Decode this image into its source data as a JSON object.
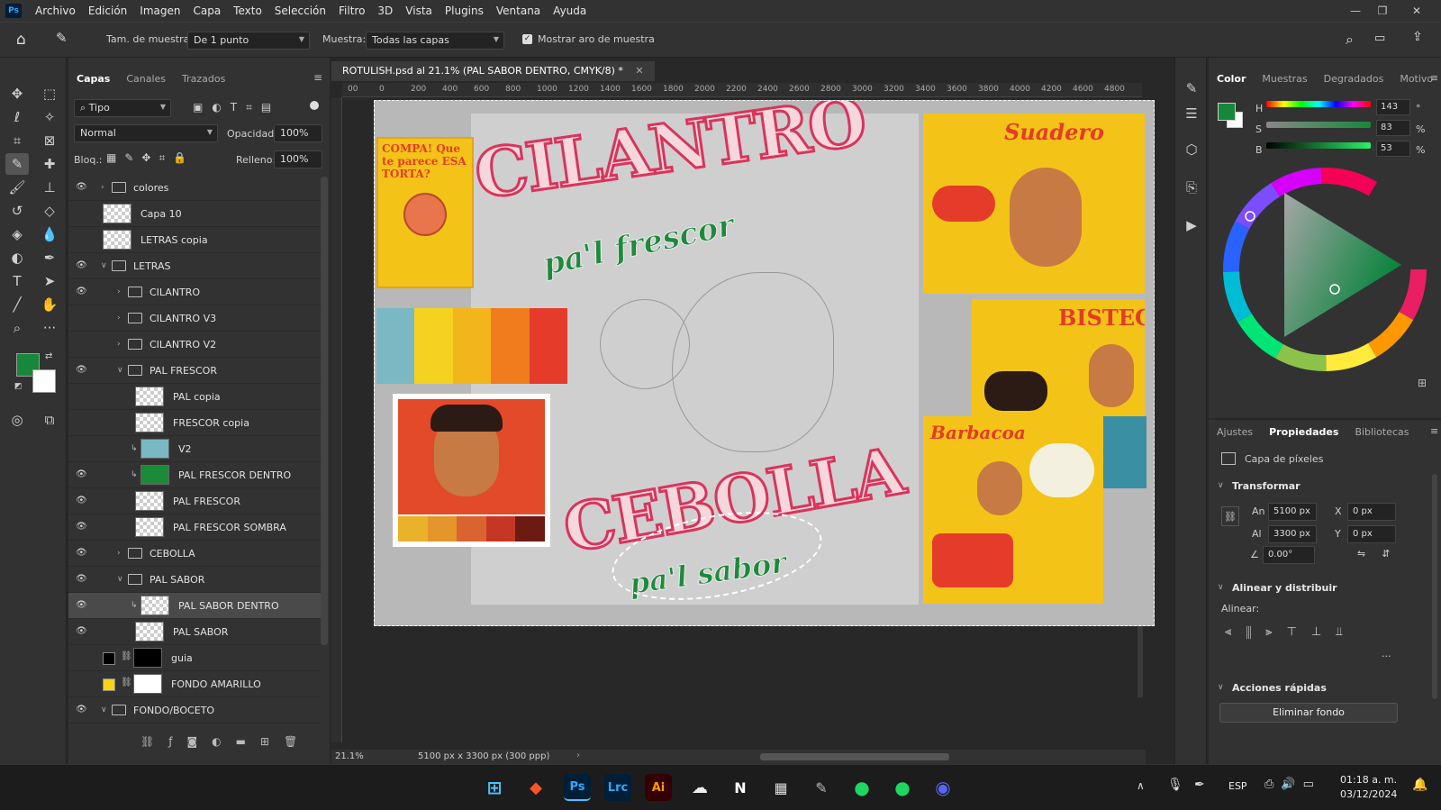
{
  "menu": {
    "logo": "Ps",
    "items": [
      "Archivo",
      "Edición",
      "Imagen",
      "Capa",
      "Texto",
      "Selección",
      "Filtro",
      "3D",
      "Vista",
      "Plugins",
      "Ventana",
      "Ayuda"
    ]
  },
  "options": {
    "sample_size_label": "Tam. de muestra:",
    "sample_size_value": "De 1 punto",
    "sample_label": "Muestra:",
    "sample_value": "Todas las capas",
    "show_ring_label": "Mostrar aro de muestra"
  },
  "layers_panel": {
    "tabs": [
      "Capas",
      "Canales",
      "Trazados"
    ],
    "filter_value": "Tipo",
    "blend_mode": "Normal",
    "opacity_label": "Opacidad:",
    "opacity_value": "100%",
    "lock_label": "Bloq.:",
    "fill_label": "Relleno:",
    "fill_value": "100%",
    "layers": [
      {
        "name": "colores",
        "visible": true,
        "kind": "folder",
        "indent": 0,
        "collapsed": true
      },
      {
        "name": "Capa 10",
        "visible": false,
        "kind": "pixel",
        "indent": 0
      },
      {
        "name": "LETRAS copia",
        "visible": false,
        "kind": "pixel",
        "indent": 0
      },
      {
        "name": "LETRAS",
        "visible": true,
        "kind": "folder",
        "indent": 0,
        "collapsed": false
      },
      {
        "name": "CILANTRO",
        "visible": true,
        "kind": "folder",
        "indent": 1,
        "collapsed": true
      },
      {
        "name": "CILANTRO V3",
        "visible": false,
        "kind": "folder",
        "indent": 1,
        "collapsed": true
      },
      {
        "name": "CILANTRO V2",
        "visible": false,
        "kind": "folder",
        "indent": 1,
        "collapsed": true
      },
      {
        "name": "PAL FRESCOR",
        "visible": true,
        "kind": "folder",
        "indent": 1,
        "collapsed": false
      },
      {
        "name": "PAL copia",
        "visible": false,
        "kind": "pixel",
        "indent": 2
      },
      {
        "name": "FRESCOR copia",
        "visible": false,
        "kind": "pixel",
        "indent": 2
      },
      {
        "name": "V2",
        "visible": false,
        "kind": "pixel",
        "indent": 2,
        "thumb_color": "#7ab8c4"
      },
      {
        "name": "PAL FRESCOR DENTRO",
        "visible": true,
        "kind": "pixel",
        "indent": 2,
        "thumb_color": "#1d8a3a"
      },
      {
        "name": "PAL FRESCOR",
        "visible": true,
        "kind": "pixel",
        "indent": 2
      },
      {
        "name": "PAL FRESCOR SOMBRA",
        "visible": true,
        "kind": "pixel",
        "indent": 2
      },
      {
        "name": "CEBOLLA",
        "visible": true,
        "kind": "folder",
        "indent": 1,
        "collapsed": true
      },
      {
        "name": "PAL SABOR",
        "visible": true,
        "kind": "folder",
        "indent": 1,
        "collapsed": false
      },
      {
        "name": "PAL SABOR DENTRO",
        "visible": true,
        "kind": "pixel",
        "indent": 2,
        "selected": true
      },
      {
        "name": "PAL SABOR",
        "visible": true,
        "kind": "pixel",
        "indent": 2
      },
      {
        "name": "guia",
        "visible": false,
        "kind": "fill",
        "indent": 0,
        "thumb_color": "#000000"
      },
      {
        "name": "FONDO AMARILLO",
        "visible": false,
        "kind": "fill",
        "indent": 0,
        "thumb_color": "#f7d417"
      },
      {
        "name": "FONDO/BOCETO",
        "visible": true,
        "kind": "folder",
        "indent": 0,
        "collapsed": false
      }
    ]
  },
  "document": {
    "tab_title": "ROTULISH.psd al 21.1% (PAL SABOR DENTRO, CMYK/8) *",
    "ruler_ticks": [
      "00",
      "0",
      "200",
      "400",
      "600",
      "800",
      "1000",
      "1200",
      "1400",
      "1600",
      "1800",
      "2000",
      "2200",
      "2400",
      "2600",
      "2800",
      "3000",
      "3200",
      "3400",
      "3600",
      "3800",
      "4000",
      "4200",
      "4600",
      "4800"
    ],
    "zoom": "21.1%",
    "size_info": "5100 px x 3300 px (300 ppp)",
    "artwork": {
      "title_word": "CILANTRO",
      "title_sub": "pa'l frescor",
      "bottom_word": "CEBOLLA",
      "bottom_sub": "pa'l sabor",
      "poster_torta": "COMPA! Que te parece ESA TORTA?",
      "poster_suadero": "Suadero",
      "poster_bistec": "BISTEC",
      "poster_barbacoa": "Barbacoa",
      "palette": [
        "#7ab8c4",
        "#f4d21f",
        "#f2b51c",
        "#f07c1e",
        "#e53b2a"
      ]
    }
  },
  "color_panel": {
    "tabs": [
      "Color",
      "Muestras",
      "Degradados",
      "Motivo"
    ],
    "h_label": "H",
    "h_value": "143",
    "h_unit": "°",
    "s_label": "S",
    "s_value": "83",
    "s_unit": "%",
    "b_label": "B",
    "b_value": "53",
    "b_unit": "%",
    "foreground": "#17883b"
  },
  "properties_panel": {
    "tabs": [
      "Ajustes",
      "Propiedades",
      "Bibliotecas"
    ],
    "layer_type": "Capa de píxeles",
    "transform_title": "Transformar",
    "w_label": "An",
    "w_value": "5100 px",
    "h_label": "Al",
    "h_value": "3300 px",
    "x_label": "X",
    "x_value": "0 px",
    "y_label": "Y",
    "y_value": "0 px",
    "angle_value": "0.00°",
    "align_title": "Alinear y distribuir",
    "align_label": "Alinear:",
    "quick_title": "Acciones rápidas",
    "remove_bg": "Eliminar fondo"
  },
  "taskbar": {
    "lang": "ESP",
    "time": "01:18 a. m.",
    "date": "03/12/2024",
    "apps": [
      "Ps",
      "Lrc",
      "Ai"
    ]
  }
}
